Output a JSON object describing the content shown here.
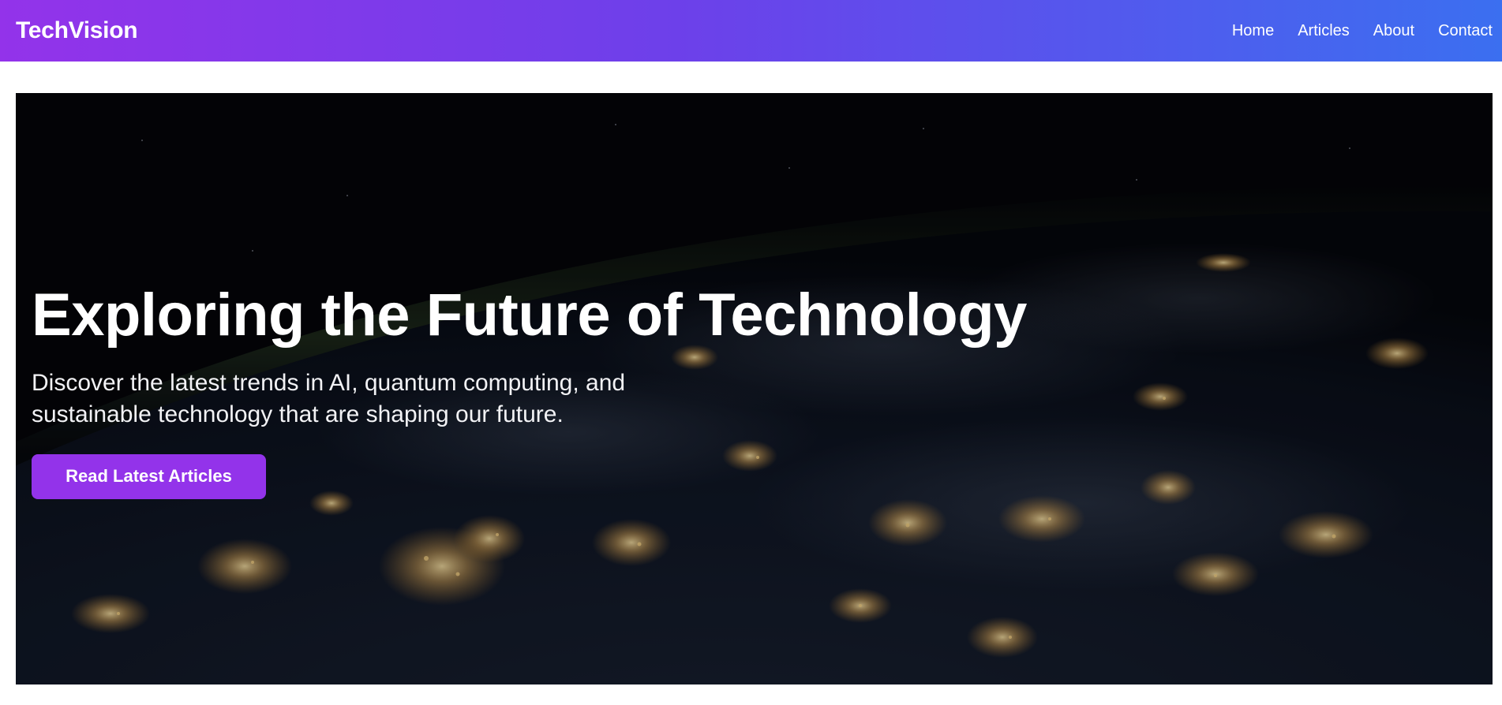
{
  "brand": {
    "name": "TechVision"
  },
  "nav": {
    "items": [
      "Home",
      "Articles",
      "About",
      "Contact"
    ]
  },
  "hero": {
    "title": "Exploring the Future of Technology",
    "subtitle": "Discover the latest trends in AI, quantum computing, and sustainable technology that are shaping our future.",
    "cta_label": "Read Latest Articles",
    "background": "earth-at-night-image"
  },
  "colors": {
    "gradient_start": "#9333ea",
    "gradient_end": "#3b6ff0",
    "cta": "#9333ea"
  }
}
